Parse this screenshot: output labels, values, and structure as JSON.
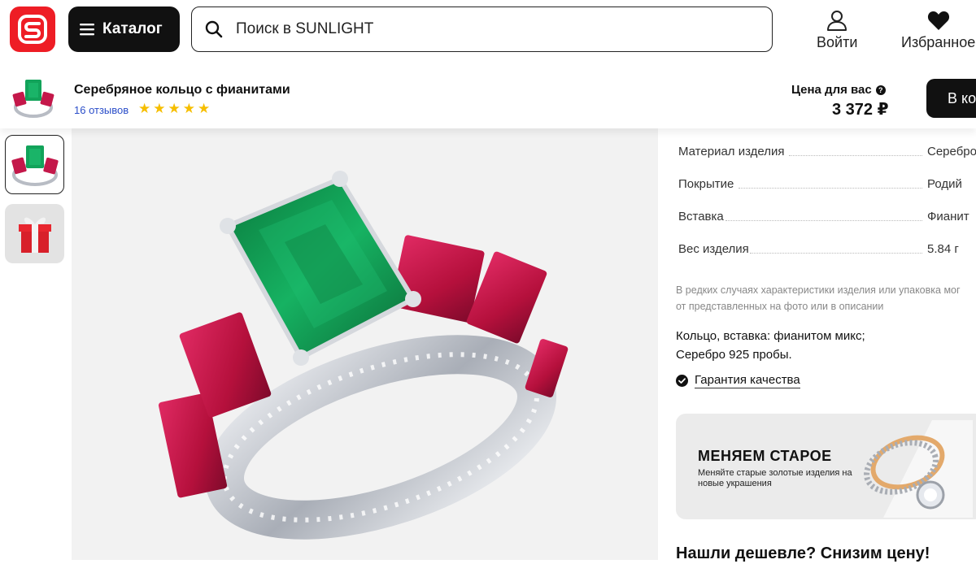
{
  "header": {
    "catalog_label": "Каталог",
    "search_placeholder": "Поиск в SUNLIGHT",
    "login_label": "Войти",
    "favorites_label": "Избранное"
  },
  "product_bar": {
    "title": "Серебряное кольцо с фианитами",
    "reviews": "16 отзывов",
    "rating_stars": 5,
    "price_label": "Цена для вас",
    "price": "3 372 ₽",
    "buy_label": "В корзину"
  },
  "specs": [
    {
      "label": "Материал изделия",
      "value": "Серебро"
    },
    {
      "label": "Покрытие",
      "value": "Родий"
    },
    {
      "label": "Вставка",
      "value": "Фианит"
    },
    {
      "label": "Вес изделия",
      "value": "5.84 г"
    }
  ],
  "note": {
    "line1": "В редких случаях характеристики изделия или упаковка мог",
    "line2": "от представленных на фото или в описании"
  },
  "description": {
    "line1": "Кольцо, вставка: фианитом микс;",
    "line2": "Серебро 925 пробы."
  },
  "guarantee_label": "Гарантия качества",
  "promo": {
    "title": "МЕНЯЕМ СТАРОЕ",
    "subtitle": "Меняйте старые золотые изделия на новые украшения"
  },
  "cheaper_heading": "Нашли дешевле? Снизим цену!",
  "colors": {
    "brand_red": "#ee1d25",
    "emerald": "#12a35a",
    "ruby": "#c4184a",
    "star": "#f6be00",
    "link": "#2b4ec9"
  }
}
